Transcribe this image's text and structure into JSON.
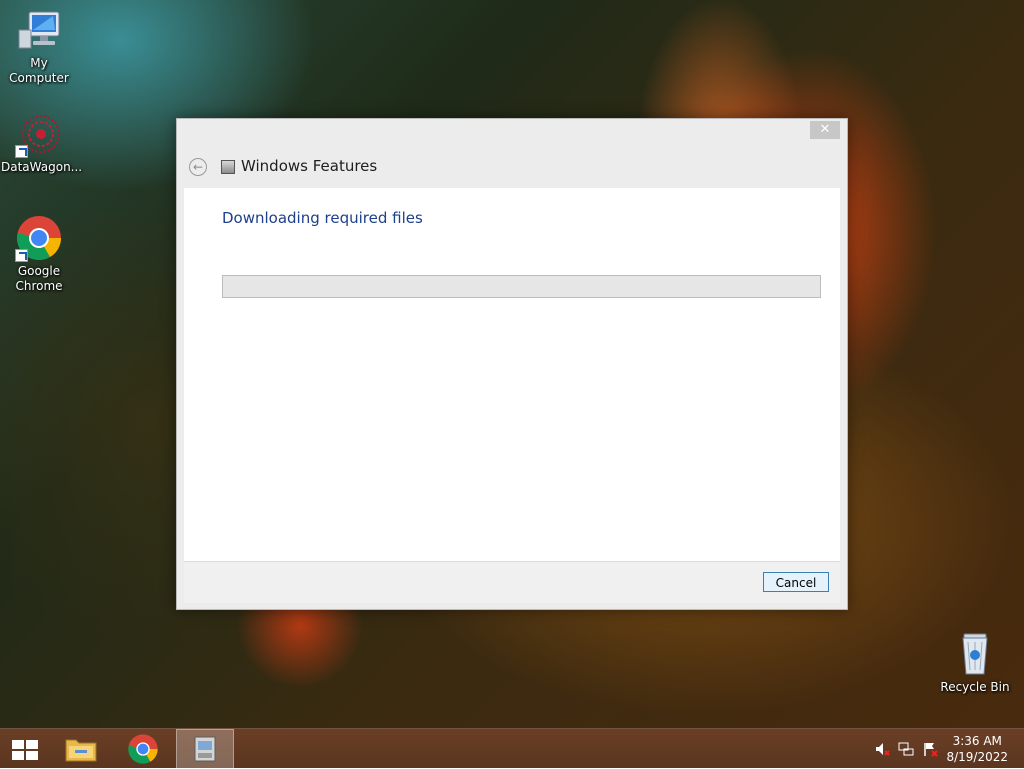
{
  "desktop": {
    "icons": [
      {
        "label": "My Computer"
      },
      {
        "label": "DataWagon..."
      },
      {
        "label": "Google Chrome"
      }
    ],
    "recycle_bin": {
      "label": "Recycle Bin"
    }
  },
  "dialog": {
    "title": "Windows Features",
    "heading": "Downloading required files",
    "progress": 0,
    "close_glyph": "✕",
    "back_glyph": "←",
    "cancel_label": "Cancel"
  },
  "taskbar": {
    "items": [
      {
        "name": "start",
        "icon": "windows-logo-icon"
      },
      {
        "name": "file-explorer",
        "icon": "folder-icon"
      },
      {
        "name": "google-chrome",
        "icon": "chrome-icon"
      },
      {
        "name": "windows-features",
        "icon": "windows-features-icon",
        "active": true
      }
    ],
    "tray": {
      "icons": [
        "volume-muted-icon",
        "network-icon",
        "action-center-flag-icon"
      ],
      "time": "3:36 AM",
      "date": "8/19/2022"
    }
  },
  "colors": {
    "heading": "#1e3f8c",
    "taskbar": "#5b3520",
    "progress_fill": "#06b025"
  }
}
